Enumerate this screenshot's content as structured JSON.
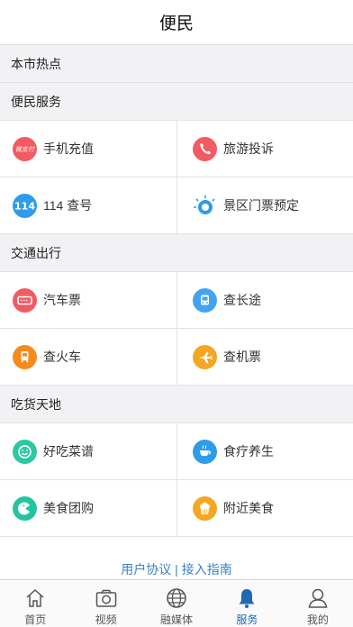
{
  "header": {
    "title": "便民"
  },
  "sections": {
    "hot": "本市热点",
    "service": "便民服务",
    "traffic": "交通出行",
    "food": "吃货天地"
  },
  "services": {
    "recharge": "手机充值",
    "complaint": "旅游投诉",
    "lookup114": "114 查号",
    "icon_114_text": "114",
    "icon_recharge_text": "微支付",
    "ticket": "景区门票预定"
  },
  "traffic": {
    "bus": "汽车票",
    "longtrip": "查长途",
    "train": "查火车",
    "flight": "查机票"
  },
  "food": {
    "recipes": "好吃菜谱",
    "diet": "食疗养生",
    "groupbuy": "美食团购",
    "nearby": "附近美食"
  },
  "footer": {
    "link": "用户协议 | 接入指南"
  },
  "tabs": [
    {
      "label": "首页",
      "icon": "home-icon"
    },
    {
      "label": "视频",
      "icon": "camera-icon"
    },
    {
      "label": "融媒体",
      "icon": "globe-icon"
    },
    {
      "label": "服务",
      "icon": "bell-icon"
    },
    {
      "label": "我的",
      "icon": "person-icon"
    }
  ],
  "colors": {
    "accent": "#1e6ab4",
    "red": "#f25b63",
    "blue": "#43a3f1",
    "orange": "#f5a623",
    "teal": "#31c2a6",
    "green": "#24c4a0"
  }
}
